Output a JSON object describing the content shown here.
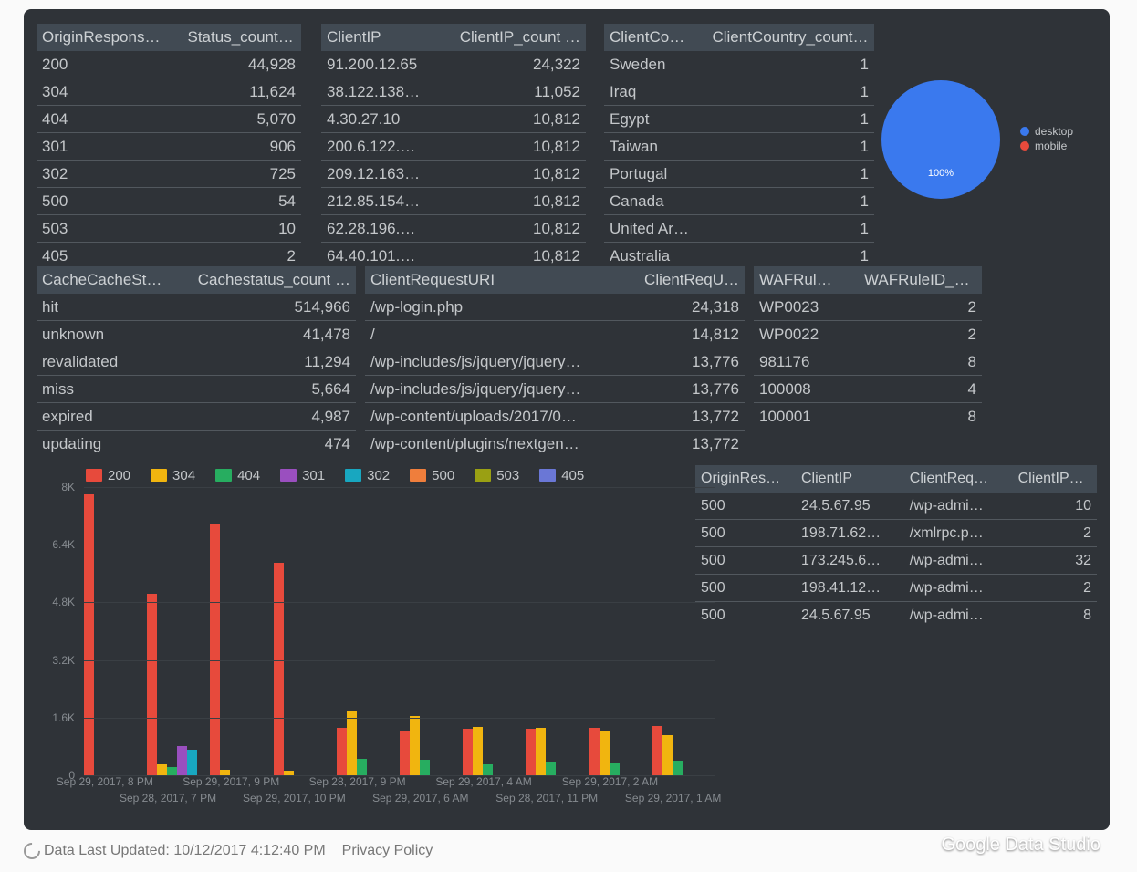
{
  "tables": {
    "status": {
      "headers": [
        "OriginRespons…",
        "Status_count …"
      ],
      "rows": [
        [
          "200",
          "44,928"
        ],
        [
          "304",
          "11,624"
        ],
        [
          "404",
          "5,070"
        ],
        [
          "301",
          "906"
        ],
        [
          "302",
          "725"
        ],
        [
          "500",
          "54"
        ],
        [
          "503",
          "10"
        ],
        [
          "405",
          "2"
        ]
      ]
    },
    "clientip": {
      "headers": [
        "ClientIP",
        "ClientIP_count …"
      ],
      "rows": [
        [
          "91.200.12.65",
          "24,322"
        ],
        [
          "38.122.138…",
          "11,052"
        ],
        [
          "4.30.27.10",
          "10,812"
        ],
        [
          "200.6.122.…",
          "10,812"
        ],
        [
          "209.12.163…",
          "10,812"
        ],
        [
          "212.85.154…",
          "10,812"
        ],
        [
          "62.28.196.…",
          "10,812"
        ],
        [
          "64.40.101.…",
          "10,812"
        ]
      ]
    },
    "country": {
      "headers": [
        "ClientCo…",
        "ClientCountry_count …"
      ],
      "rows": [
        [
          "Sweden",
          "1"
        ],
        [
          "Iraq",
          "1"
        ],
        [
          "Egypt",
          "1"
        ],
        [
          "Taiwan",
          "1"
        ],
        [
          "Portugal",
          "1"
        ],
        [
          "Canada",
          "1"
        ],
        [
          "United Ar…",
          "1"
        ],
        [
          "Australia",
          "1"
        ]
      ]
    },
    "cache": {
      "headers": [
        "CacheCacheSt…",
        "Cachestatus_count …"
      ],
      "rows": [
        [
          "hit",
          "514,966"
        ],
        [
          "unknown",
          "41,478"
        ],
        [
          "revalidated",
          "11,294"
        ],
        [
          "miss",
          "5,664"
        ],
        [
          "expired",
          "4,987"
        ],
        [
          "updating",
          "474"
        ]
      ]
    },
    "uri": {
      "headers": [
        "ClientRequestURI",
        "ClientReqU…"
      ],
      "rows": [
        [
          "/wp-login.php",
          "24,318"
        ],
        [
          "/",
          "14,812"
        ],
        [
          "/wp-includes/js/jquery/jquery…",
          "13,776"
        ],
        [
          "/wp-includes/js/jquery/jquery…",
          "13,776"
        ],
        [
          "/wp-content/uploads/2017/0…",
          "13,772"
        ],
        [
          "/wp-content/plugins/nextgen…",
          "13,772"
        ]
      ]
    },
    "waf": {
      "headers": [
        "WAFRul…",
        "WAFRuleID_c…"
      ],
      "rows": [
        [
          "WP0023",
          "2"
        ],
        [
          "WP0022",
          "2"
        ],
        [
          "981176",
          "8"
        ],
        [
          "100008",
          "4"
        ],
        [
          "100001",
          "8"
        ]
      ]
    },
    "errors": {
      "headers": [
        "OriginRes…",
        "ClientIP",
        "ClientReq…",
        "ClientIP_…"
      ],
      "rows": [
        [
          "500",
          "24.5.67.95",
          "/wp-admi…",
          "10"
        ],
        [
          "500",
          "198.71.62…",
          "/xmlrpc.p…",
          "2"
        ],
        [
          "500",
          "173.245.6…",
          "/wp-admi…",
          "32"
        ],
        [
          "500",
          "198.41.12…",
          "/wp-admi…",
          "2"
        ],
        [
          "500",
          "24.5.67.95",
          "/wp-admi…",
          "8"
        ]
      ]
    }
  },
  "chart_data": {
    "type": "bar",
    "series_names": [
      "200",
      "304",
      "404",
      "301",
      "302",
      "500",
      "503",
      "405"
    ],
    "series_colors": [
      "#e74a3c",
      "#f1b50f",
      "#27ad60",
      "#9a4fbf",
      "#18a7c0",
      "#ef7e3c",
      "#9aa013",
      "#6a77d6"
    ],
    "categories": [
      "Sep 29, 2017, 8 PM",
      "Sep 28, 2017, 7 PM",
      "Sep 29, 2017, 9 PM",
      "Sep 29, 2017, 10 PM",
      "Sep 28, 2017, 9 PM",
      "Sep 29, 2017, 6 AM",
      "Sep 29, 2017, 4 AM",
      "Sep 28, 2017, 11 PM",
      "Sep 29, 2017, 2 AM",
      "Sep 29, 2017, 1 AM"
    ],
    "values": [
      {
        "200": 7800,
        "304": 0,
        "404": 0,
        "301": 0,
        "302": 0,
        "500": 0,
        "503": 0,
        "405": 0
      },
      {
        "200": 5050,
        "304": 300,
        "404": 220,
        "301": 820,
        "302": 720,
        "500": 0,
        "503": 0,
        "405": 0
      },
      {
        "200": 6950,
        "304": 150,
        "404": 0,
        "301": 0,
        "302": 0,
        "500": 0,
        "503": 0,
        "405": 0
      },
      {
        "200": 5900,
        "304": 120,
        "404": 0,
        "301": 0,
        "302": 0,
        "500": 0,
        "503": 0,
        "405": 0
      },
      {
        "200": 1320,
        "304": 1770,
        "404": 450,
        "301": 0,
        "302": 0,
        "500": 0,
        "503": 0,
        "405": 0
      },
      {
        "200": 1230,
        "304": 1650,
        "404": 440,
        "301": 0,
        "302": 0,
        "500": 0,
        "503": 0,
        "405": 0
      },
      {
        "200": 1280,
        "304": 1350,
        "404": 310,
        "301": 0,
        "302": 0,
        "500": 0,
        "503": 0,
        "405": 0
      },
      {
        "200": 1280,
        "304": 1310,
        "404": 380,
        "301": 0,
        "302": 0,
        "500": 0,
        "503": 0,
        "405": 0
      },
      {
        "200": 1320,
        "304": 1250,
        "404": 320,
        "301": 0,
        "302": 0,
        "500": 0,
        "503": 0,
        "405": 0
      },
      {
        "200": 1370,
        "304": 1120,
        "404": 400,
        "301": 0,
        "302": 0,
        "500": 0,
        "503": 0,
        "405": 0
      }
    ],
    "ymax": 8000,
    "yticks": [
      0,
      1600,
      3200,
      4800,
      6400,
      8000
    ],
    "ytick_labels": [
      "0",
      "1.6K",
      "3.2K",
      "4.8K",
      "6.4K",
      "8K"
    ]
  },
  "pie": {
    "labels": [
      "desktop",
      "mobile"
    ],
    "colors": [
      "#3a79ee",
      "#e74a3c"
    ],
    "center_label": "100%"
  },
  "footer": {
    "updated_label": "Data Last Updated: 10/12/2017 4:12:40 PM",
    "privacy": "Privacy Policy",
    "brand": "Google Data Studio"
  }
}
